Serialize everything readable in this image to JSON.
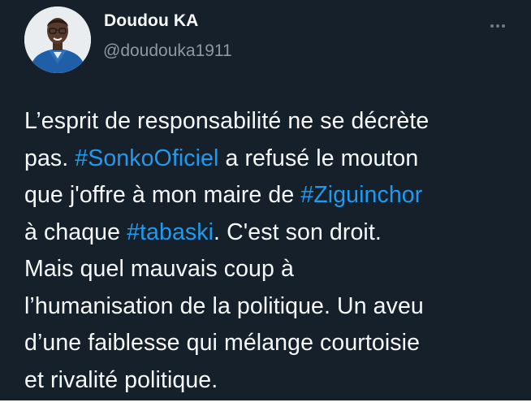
{
  "author": {
    "name": "Doudou KA",
    "handle": "@doudouka1911",
    "avatar_icon": "profile-photo"
  },
  "menu": {
    "icon": "more-horizontal-icon"
  },
  "tweet": {
    "lines": [
      [
        {
          "text": "L’esprit de responsabilité ne se décrète"
        }
      ],
      [
        {
          "text": "pas. "
        },
        {
          "text": "#SonkoOficiel",
          "hashtag": true
        },
        {
          "text": " a refusé le mouton"
        }
      ],
      [
        {
          "text": "que j'offre à mon maire de "
        },
        {
          "text": "#Ziguinchor",
          "hashtag": true
        }
      ],
      [
        {
          "text": "à chaque "
        },
        {
          "text": "#tabaski",
          "hashtag": true
        },
        {
          "text": ". C'est son droit."
        }
      ],
      [
        {
          "text": "Mais quel mauvais coup à"
        }
      ],
      [
        {
          "text": "l’humanisation de la politique. Un aveu"
        }
      ],
      [
        {
          "text": "d’une faiblesse qui mélange courtoisie"
        }
      ],
      [
        {
          "text": "et rivalité politique."
        }
      ]
    ]
  },
  "colors": {
    "background": "#15202b",
    "text": "#f7f9f9",
    "secondary": "#8b98a5",
    "accent": "#1d9bf0"
  }
}
